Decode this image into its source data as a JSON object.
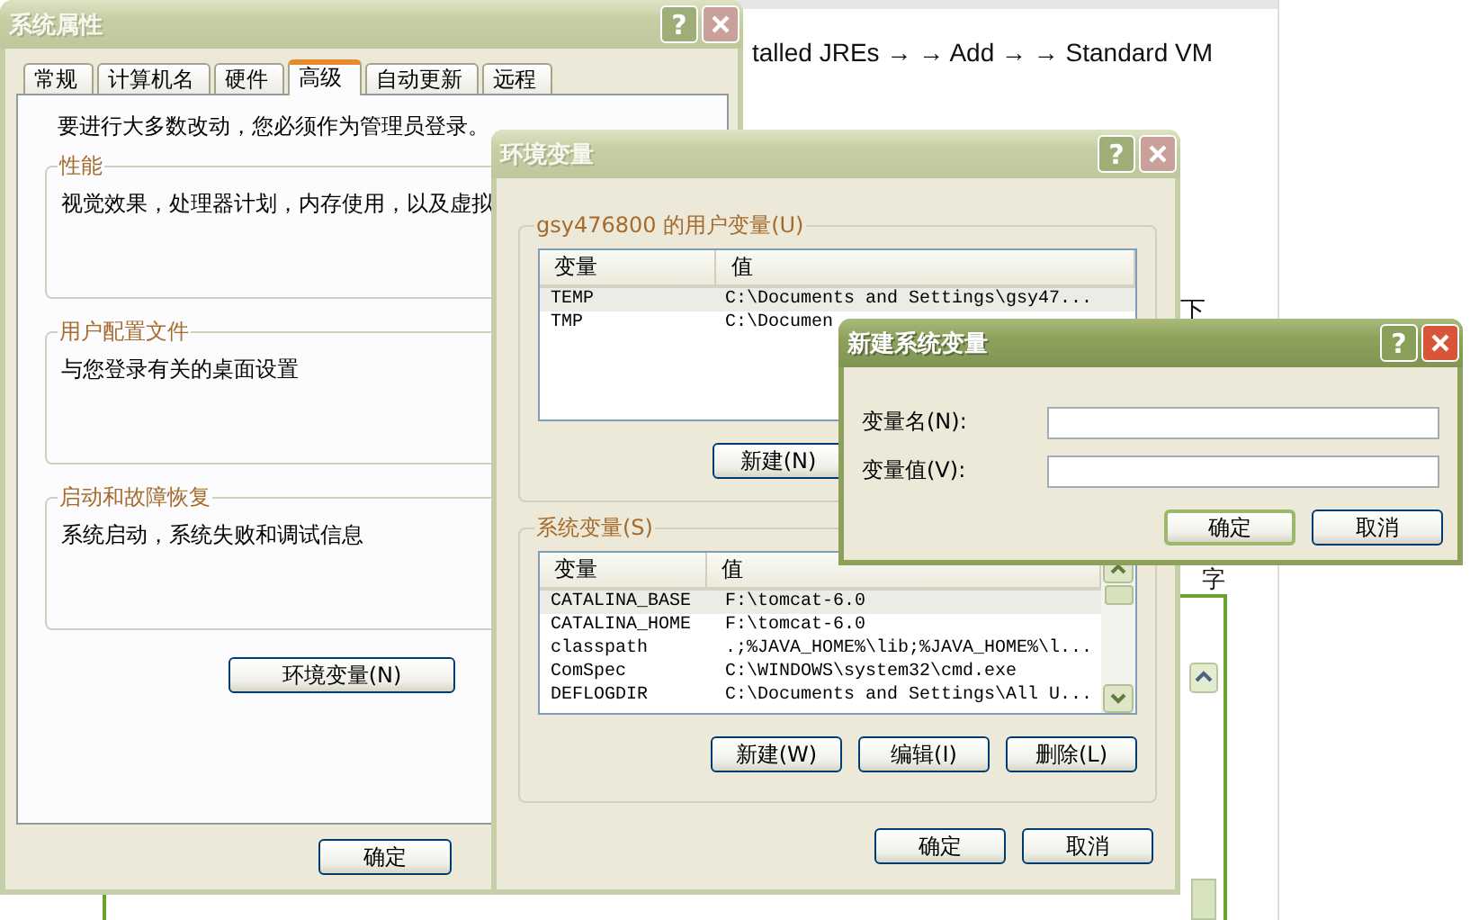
{
  "background": {
    "texts": [
      {
        "kind": "line",
        "text": "talled JREs → → Add → → Standard VM"
      },
      {
        "kind": "glyph",
        "text": "下"
      },
      {
        "kind": "glyph2",
        "text": "字"
      }
    ]
  },
  "system_properties": {
    "title": "系统属性",
    "active": false,
    "help": "?",
    "tabs": [
      {
        "label": "常规",
        "selected": false
      },
      {
        "label": "计算机名",
        "selected": false
      },
      {
        "label": "硬件",
        "selected": false
      },
      {
        "label": "高级",
        "selected": true
      },
      {
        "label": "自动更新",
        "selected": false
      },
      {
        "label": "远程",
        "selected": false
      }
    ],
    "notice": "要进行大多数改动，您必须作为管理员登录。",
    "groups": [
      {
        "title": "性能",
        "text": "视觉效果，处理器计划，内存使用，以及虚拟"
      },
      {
        "title": "用户配置文件",
        "text": "与您登录有关的桌面设置"
      },
      {
        "title": "启动和故障恢复",
        "text": "系统启动，系统失败和调试信息"
      }
    ],
    "panel_button": "环境变量(N)",
    "buttons": [
      "确定"
    ]
  },
  "environment_variables": {
    "title": "环境变量",
    "active": false,
    "help": "?",
    "user_vars": {
      "title": "gsy476800 的用户变量(U)",
      "columns": [
        "变量",
        "值"
      ],
      "scrollbar": false,
      "rows": [
        {
          "name": "TEMP",
          "value": "C:\\Documents and Settings\\gsy47...",
          "selected": true
        },
        {
          "name": "TMP",
          "value": "C:\\Documen",
          "selected": false
        }
      ],
      "buttons": [
        "新建(N)"
      ]
    },
    "system_vars": {
      "title": "系统变量(S)",
      "columns": [
        "变量",
        "值"
      ],
      "scrollbar": true,
      "rows": [
        {
          "name": "CATALINA_BASE",
          "value": "F:\\tomcat-6.0",
          "selected": true
        },
        {
          "name": "CATALINA_HOME",
          "value": "F:\\tomcat-6.0",
          "selected": false
        },
        {
          "name": "classpath",
          "value": ".;%JAVA_HOME%\\lib;%JAVA_HOME%\\l...",
          "selected": false
        },
        {
          "name": "ComSpec",
          "value": "C:\\WINDOWS\\system32\\cmd.exe",
          "selected": false
        },
        {
          "name": "DEFLOGDIR",
          "value": "C:\\Documents and Settings\\All U...",
          "selected": false
        }
      ],
      "buttons": [
        "新建(W)",
        "编辑(I)",
        "删除(L)"
      ]
    },
    "buttons": [
      "确定",
      "取消"
    ]
  },
  "new_variable": {
    "title": "新建系统变量",
    "active": true,
    "help": "?",
    "fields": [
      {
        "label": "变量名(N):"
      },
      {
        "label": "变量值(V):"
      }
    ],
    "buttons": [
      {
        "label": "确定",
        "default": true
      },
      {
        "label": "取消",
        "default": false
      }
    ]
  }
}
